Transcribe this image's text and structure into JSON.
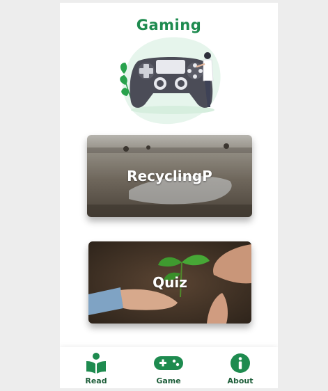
{
  "header": {
    "title": "Gaming"
  },
  "cards": [
    {
      "label": "RecyclingP"
    },
    {
      "label": "Quiz"
    }
  ],
  "bottom_nav": {
    "items": [
      {
        "label": "Read",
        "icon": "book-reader-icon"
      },
      {
        "label": "Game",
        "icon": "gamepad-icon"
      },
      {
        "label": "About",
        "icon": "info-circle-icon"
      }
    ]
  },
  "colors": {
    "accent": "#1e8b4f",
    "nav_text": "#1e5e3a",
    "background": "#ededed",
    "panel": "#ffffff"
  }
}
